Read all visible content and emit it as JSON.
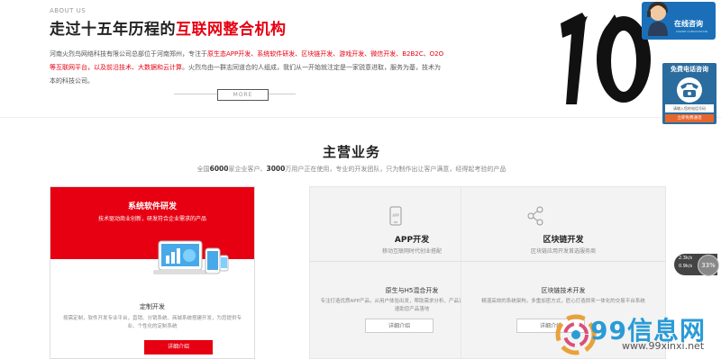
{
  "about": {
    "en_label": "ABOUT US",
    "title_black": "走过十五年历程的",
    "title_red": "互联网整合机构",
    "desc_1": "河南火烈鸟网络科技有限公司总部位于河南郑州，专注于",
    "desc_hl_1": "原生态APP开发、系统软件研发、区块链开发、游戏开发、微信开发、B2B2C、O2O等互联网平台，以及前沿技术、大数据和云计算",
    "desc_2": "。火烈鸟由一群志同道合的人组成，我们从一开始就注定是一家锐意进取，服务为基，技术为本的科技公司。",
    "more_label": "MORE",
    "big_number": "10"
  },
  "business": {
    "title": "主营业务",
    "sub_1": "全国",
    "sub_num_1": "6000",
    "sub_2": "家企业客户、",
    "sub_num_2": "3000",
    "sub_3": "万用户正在使用，专业的开发团队，只为制作出让客户满意，经得起考验的产品",
    "cards": [
      {
        "title": "系统软件研发",
        "desc": "技术驱动商业创新，研发符合企业需求的产品",
        "sub_title": "定制开发",
        "sub_desc": "按需定制，软件开发专业平台，直销、分销系统、商城系统搭建开发，为您提供专业、个性化的定制系统",
        "button": "详细介绍"
      },
      {
        "title": "APP开发",
        "desc": "移动互联网时代创业搭配",
        "icon_text": "APP",
        "sub_title": "原生与H5混合开发",
        "sub_desc": "专注打造优质APP产品，从用户体验出发，帮助需求分析、产品设计、技术研发，快速助您产品落地",
        "button": "详细介绍"
      },
      {
        "title": "区块链开发",
        "desc": "区块链应用开发首选服务商",
        "sub_title": "区块链技术开发",
        "sub_desc": "精湛高效的系统架构，多重加密方式，匠心打造即来一体化的交易平台系统",
        "button": "详细介绍"
      }
    ]
  },
  "widgets": {
    "consult_label": "在线咨询",
    "consult_small": "ONLINE CONSULTATION",
    "phone_title": "免费电话咨询",
    "phone_placeholder": "请输入您的电话号码",
    "phone_button": "立即免费通话",
    "speed_up": "2.3k/s",
    "speed_down": "0.9k/s",
    "speed_percent": "33%"
  },
  "watermark": {
    "text": "99信息网",
    "url": "www.99xinxi.net"
  },
  "colors": {
    "accent_red": "#e60012",
    "consult_blue": "#1a6fb8",
    "phone_blue": "#2b6c9e",
    "phone_orange": "#e6672e"
  }
}
